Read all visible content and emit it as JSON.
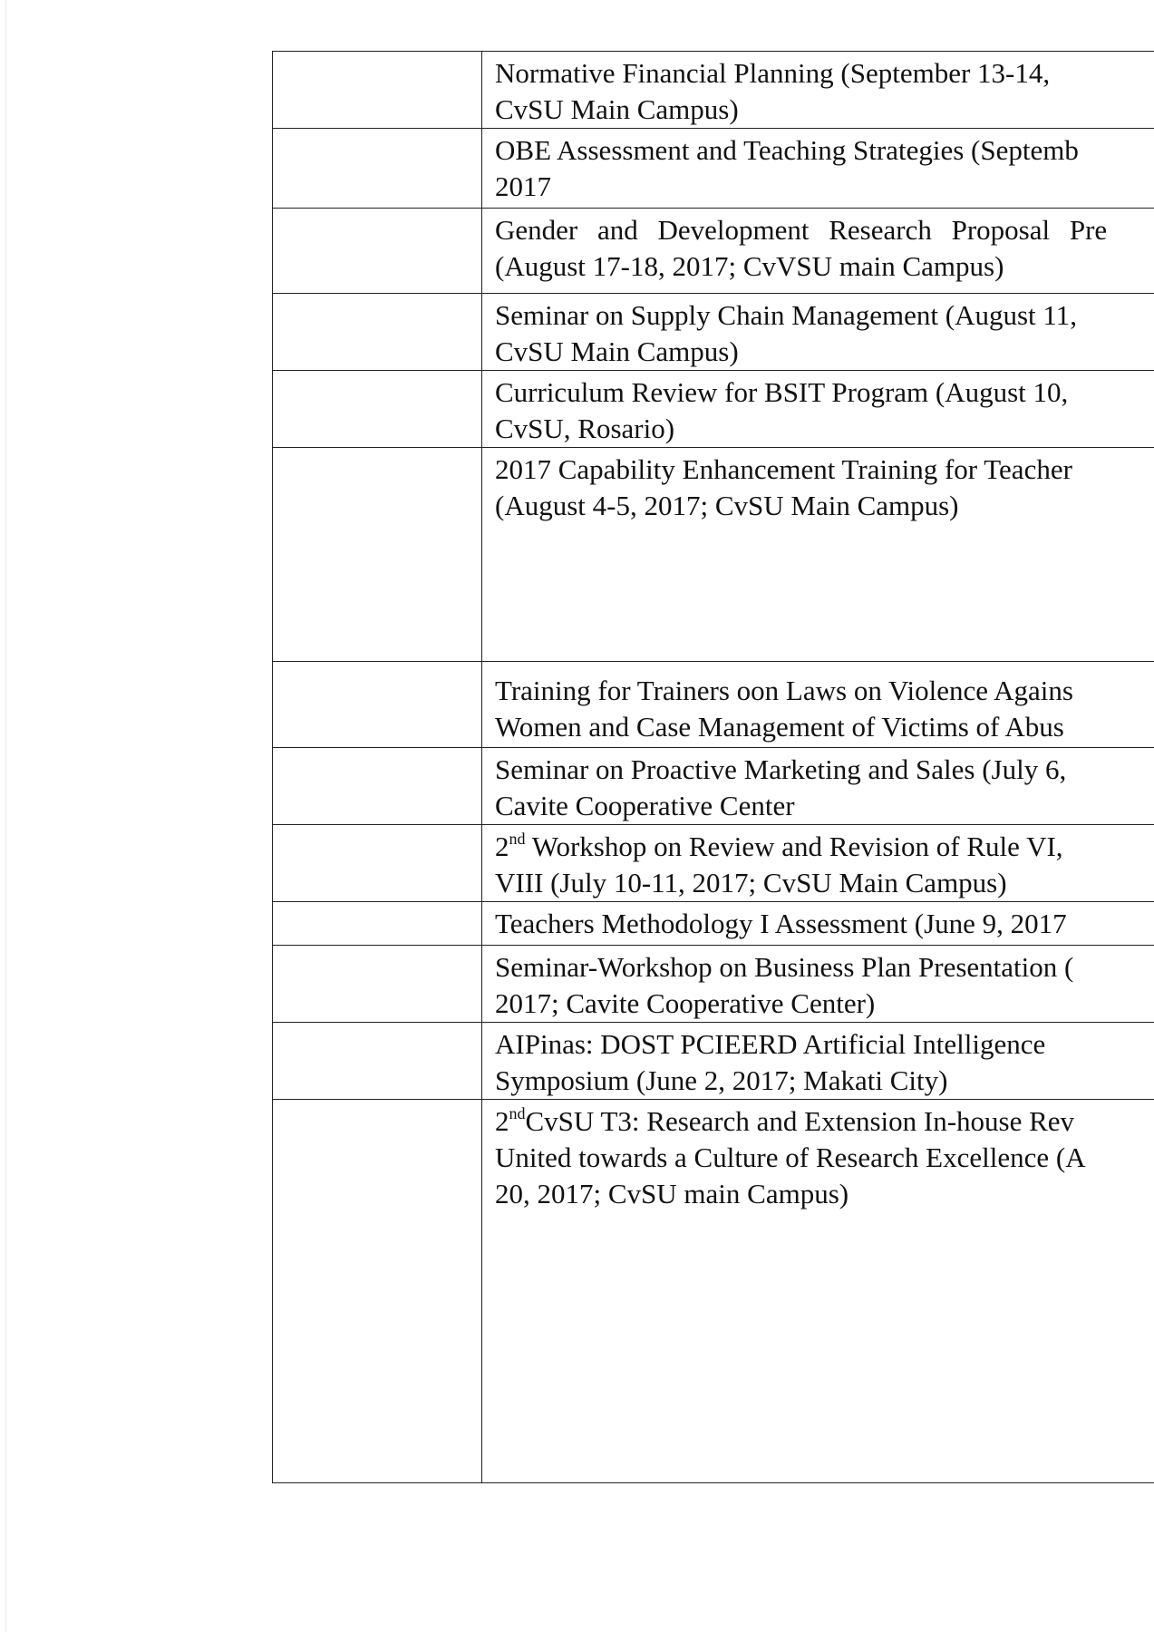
{
  "rows": [
    {
      "lines": [
        "Normative Financial Planning (September 13-14, ",
        "CvSU Main Campus)"
      ]
    },
    {
      "lines": [
        "OBE Assessment and Teaching Strategies (Septemb",
        "2017"
      ]
    },
    {
      "lines": [
        "Gender and Development Research Proposal Pre",
        "(August 17-18, 2017; CvVSU main Campus)"
      ]
    },
    {
      "lines": [
        "Seminar on Supply Chain Management (August 11,",
        "CvSU Main Campus)"
      ]
    },
    {
      "lines": [
        "Curriculum Review for BSIT Program (August 10, ",
        "CvSU, Rosario)"
      ]
    },
    {
      "lines": [
        "2017 Capability Enhancement Training for Teacher",
        "(August 4-5, 2017; CvSU Main Campus)"
      ]
    },
    {
      "lines": [
        "Training for Trainers oon Laws on Violence Agains",
        "Women and Case Management of Victims of Abus"
      ]
    },
    {
      "lines": [
        "Seminar on Proactive Marketing and Sales (July 6, ",
        "Cavite Cooperative Center"
      ]
    },
    {
      "line1_prefix": "2",
      "line1_sup": "nd",
      "line1_rest": " Workshop on Review and Revision of  Rule VI,",
      "line2": "VIII (July 10-11, 2017; CvSU Main Campus)"
    },
    {
      "lines": [
        "Teachers Methodology I Assessment (June 9, 2017"
      ]
    },
    {
      "lines": [
        "Seminar-Workshop on Business Plan Presentation (",
        "2017; Cavite Cooperative Center)"
      ]
    },
    {
      "lines": [
        "AIPinas: DOST PCIEERD Artificial Intelligence",
        "Symposium (June 2, 2017; Makati City)"
      ]
    },
    {
      "line1_prefix": "2",
      "line1_sup": "nd",
      "line1_rest": "CvSU T3: Research and Extension In-house Rev",
      "line2": "United towards a Culture of Research Excellence (A",
      "line3": "20, 2017; CvSU main Campus)"
    }
  ]
}
